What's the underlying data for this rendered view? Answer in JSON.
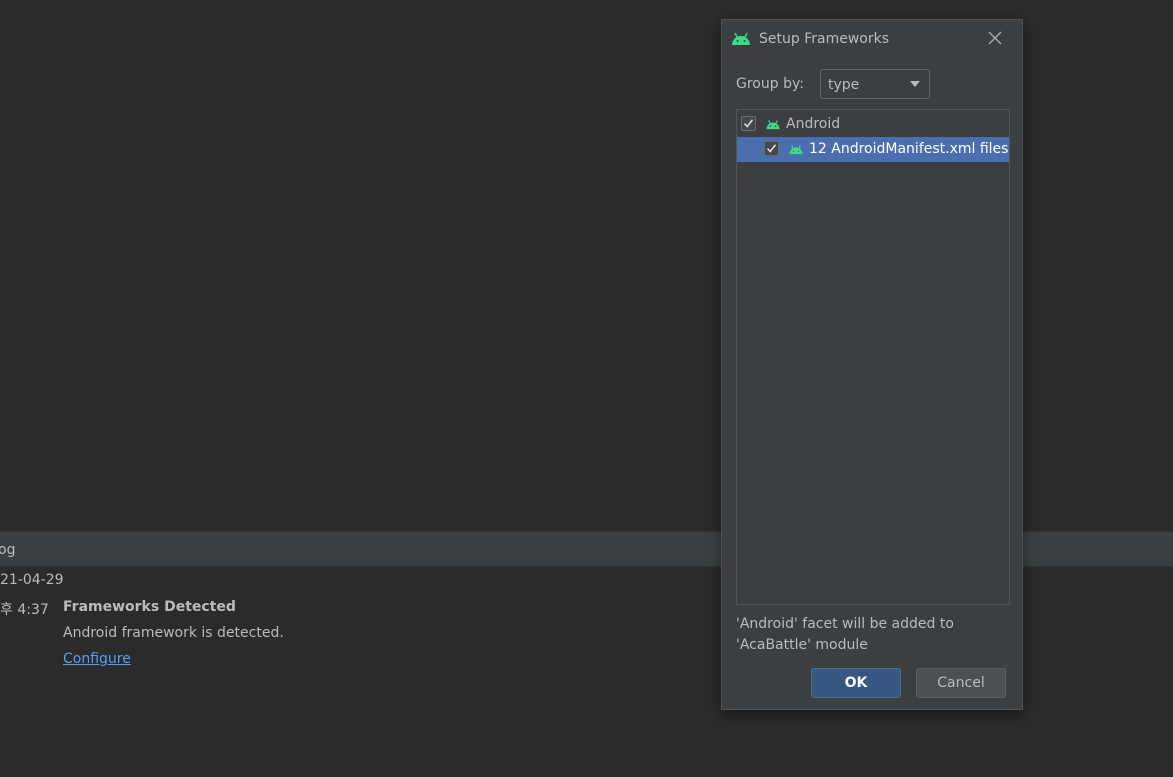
{
  "colors": {
    "background": "#2b2b2b",
    "panel": "#3c3f41",
    "selection": "#4b6eaf",
    "android_green": "#3ddc84",
    "link": "#589df6",
    "ok_button": "#365880"
  },
  "event_log": {
    "title": "og",
    "date": "21-04-29",
    "time": "후 4:37",
    "event_title": "Frameworks Detected",
    "event_message": "Android framework is detected.",
    "event_link": "Configure"
  },
  "dialog": {
    "title": "Setup Frameworks",
    "icon": "android-icon",
    "close_icon": "close-icon",
    "group_by_label": "Group by:",
    "group_by_value": "type",
    "tree": [
      {
        "label": "Android",
        "checked": true,
        "icon": "android-icon",
        "level": 0
      },
      {
        "label": "12 AndroidManifest.xml files",
        "checked": true,
        "icon": "android-icon",
        "level": 1,
        "selected": true
      }
    ],
    "facet_message": "'Android' facet will be added to 'AcaBattle' module",
    "ok_label": "OK",
    "cancel_label": "Cancel"
  }
}
